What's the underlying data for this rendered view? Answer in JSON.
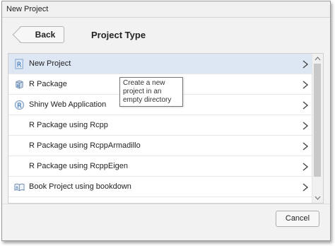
{
  "window": {
    "title": "New Project"
  },
  "header": {
    "back_label": "Back",
    "title": "Project Type"
  },
  "project_types": [
    {
      "label": "New Project",
      "icon": "r-project-icon",
      "selected": true
    },
    {
      "label": "R Package",
      "icon": "r-package-icon",
      "selected": false
    },
    {
      "label": "Shiny Web Application",
      "icon": "shiny-app-icon",
      "selected": false
    },
    {
      "label": "R Package using Rcpp",
      "icon": "",
      "selected": false
    },
    {
      "label": "R Package using RcppArmadillo",
      "icon": "",
      "selected": false
    },
    {
      "label": "R Package using RcppEigen",
      "icon": "",
      "selected": false
    },
    {
      "label": "Book Project using bookdown",
      "icon": "book-icon",
      "selected": false
    }
  ],
  "tooltip": {
    "text": "Create a new project in an empty directory"
  },
  "footer": {
    "cancel_label": "Cancel"
  },
  "colors": {
    "selected_row": "#dde7f4",
    "r_blue": "#2767b0"
  }
}
